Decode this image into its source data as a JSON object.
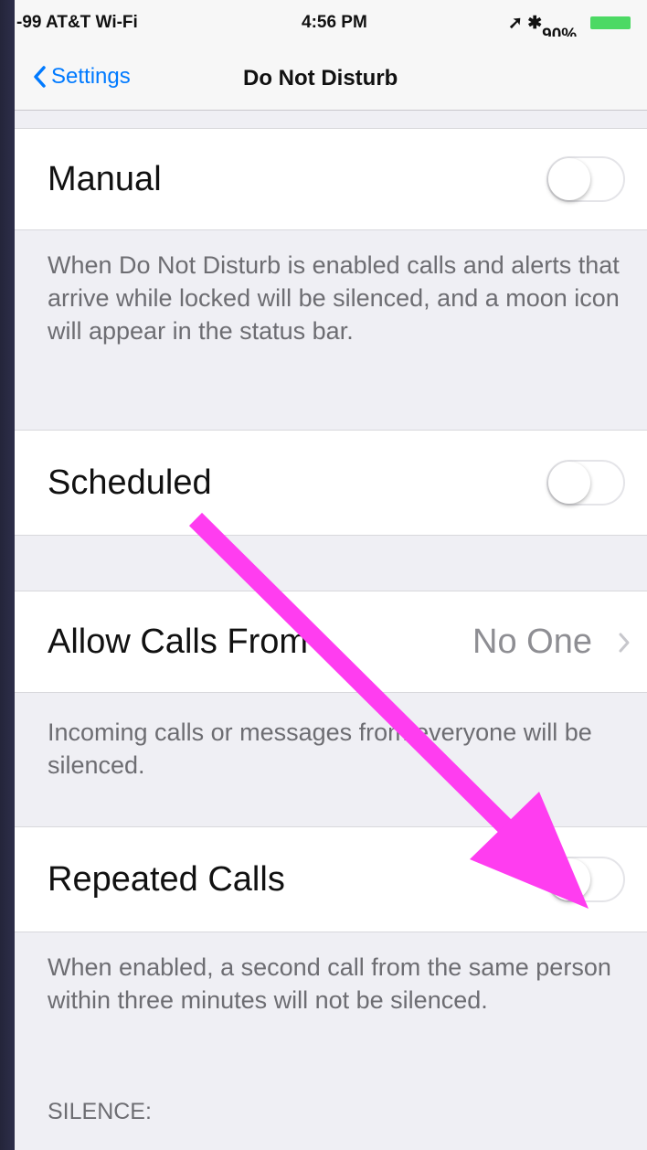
{
  "status_bar": {
    "carrier": "-99 AT&T Wi-Fi",
    "time": "4:56 PM",
    "battery": "90%"
  },
  "nav": {
    "back_label": "Settings",
    "title": "Do Not Disturb"
  },
  "manual": {
    "label": "Manual",
    "enabled": false
  },
  "manual_footer": "When Do Not Disturb is enabled calls and alerts that arrive while locked will be silenced, and a moon icon will appear in the status bar.",
  "scheduled": {
    "label": "Scheduled",
    "enabled": false
  },
  "allow_calls": {
    "label": "Allow Calls From",
    "value": "No One"
  },
  "allow_calls_footer": "Incoming calls or messages from everyone will be silenced.",
  "repeated_calls": {
    "label": "Repeated Calls",
    "enabled": false
  },
  "repeated_calls_footer": "When enabled, a second call from the same person within three minutes will not be silenced.",
  "silence_header": "SILENCE:",
  "colors": {
    "accent": "#007aff",
    "annotation_arrow": "#ff3df0"
  }
}
